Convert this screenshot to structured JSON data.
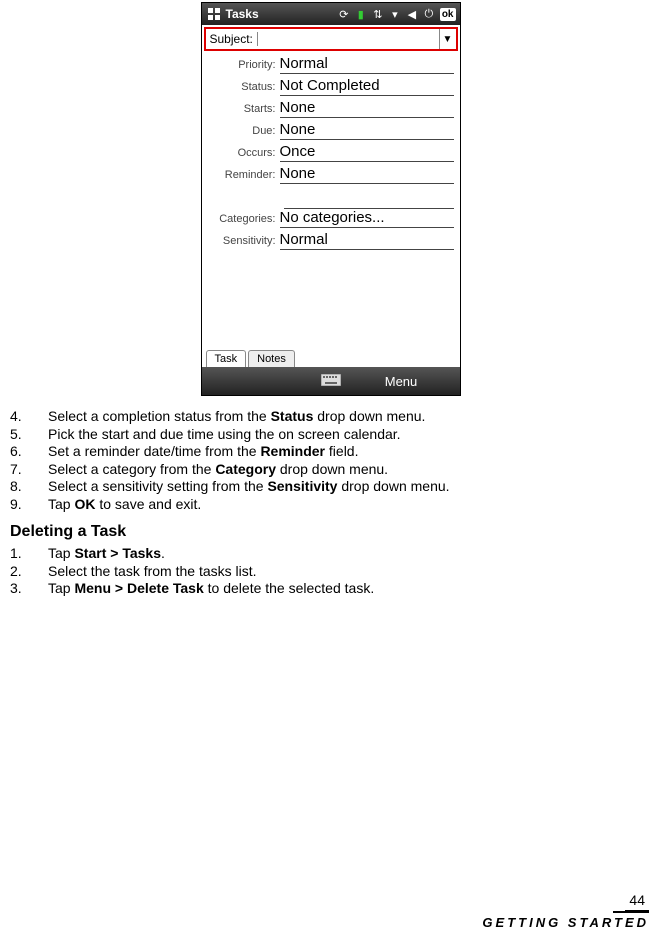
{
  "phone": {
    "title": "Tasks",
    "ok": "ok",
    "subject_label": "Subject:",
    "subject_value": "",
    "fields": [
      {
        "label": "Priority:",
        "value": "Normal"
      },
      {
        "label": "Status:",
        "value": "Not Completed"
      },
      {
        "label": "Starts:",
        "value": "None"
      },
      {
        "label": "Due:",
        "value": "None"
      },
      {
        "label": "Occurs:",
        "value": "Once"
      },
      {
        "label": "Reminder:",
        "value": "None"
      },
      {
        "label": "Categories:",
        "value": "No categories..."
      },
      {
        "label": "Sensitivity:",
        "value": "Normal"
      }
    ],
    "tabs": [
      "Task",
      "Notes"
    ],
    "softkey_left": "",
    "softkey_right": "Menu"
  },
  "instructions1": [
    {
      "n": "4.",
      "pre": "Select a completion status from the ",
      "b": "Status",
      "post": " drop down menu."
    },
    {
      "n": "5.",
      "pre": "Pick the start and due time using the on screen calendar.",
      "b": "",
      "post": ""
    },
    {
      "n": "6.",
      "pre": "Set a reminder date/time from the ",
      "b": "Reminder",
      "post": " field."
    },
    {
      "n": "7.",
      "pre": "Select a category from the ",
      "b": "Category",
      "post": " drop down menu."
    },
    {
      "n": "8.",
      "pre": "Select a sensitivity setting from the ",
      "b": "Sensitivity",
      "post": " drop down menu."
    },
    {
      "n": "9.",
      "pre": "Tap ",
      "b": "OK",
      "post": " to save and exit."
    }
  ],
  "section_heading": "Deleting a Task",
  "instructions2": [
    {
      "n": "1.",
      "pre": "Tap ",
      "b": "Start > Tasks",
      "post": "."
    },
    {
      "n": "2.",
      "pre": "Select the task from the tasks list.",
      "b": "",
      "post": ""
    },
    {
      "n": "3.",
      "pre": "Tap ",
      "b": "Menu > Delete Task",
      "post": " to delete the selected task."
    }
  ],
  "page_number": "44",
  "footer_label": "Getting Started"
}
